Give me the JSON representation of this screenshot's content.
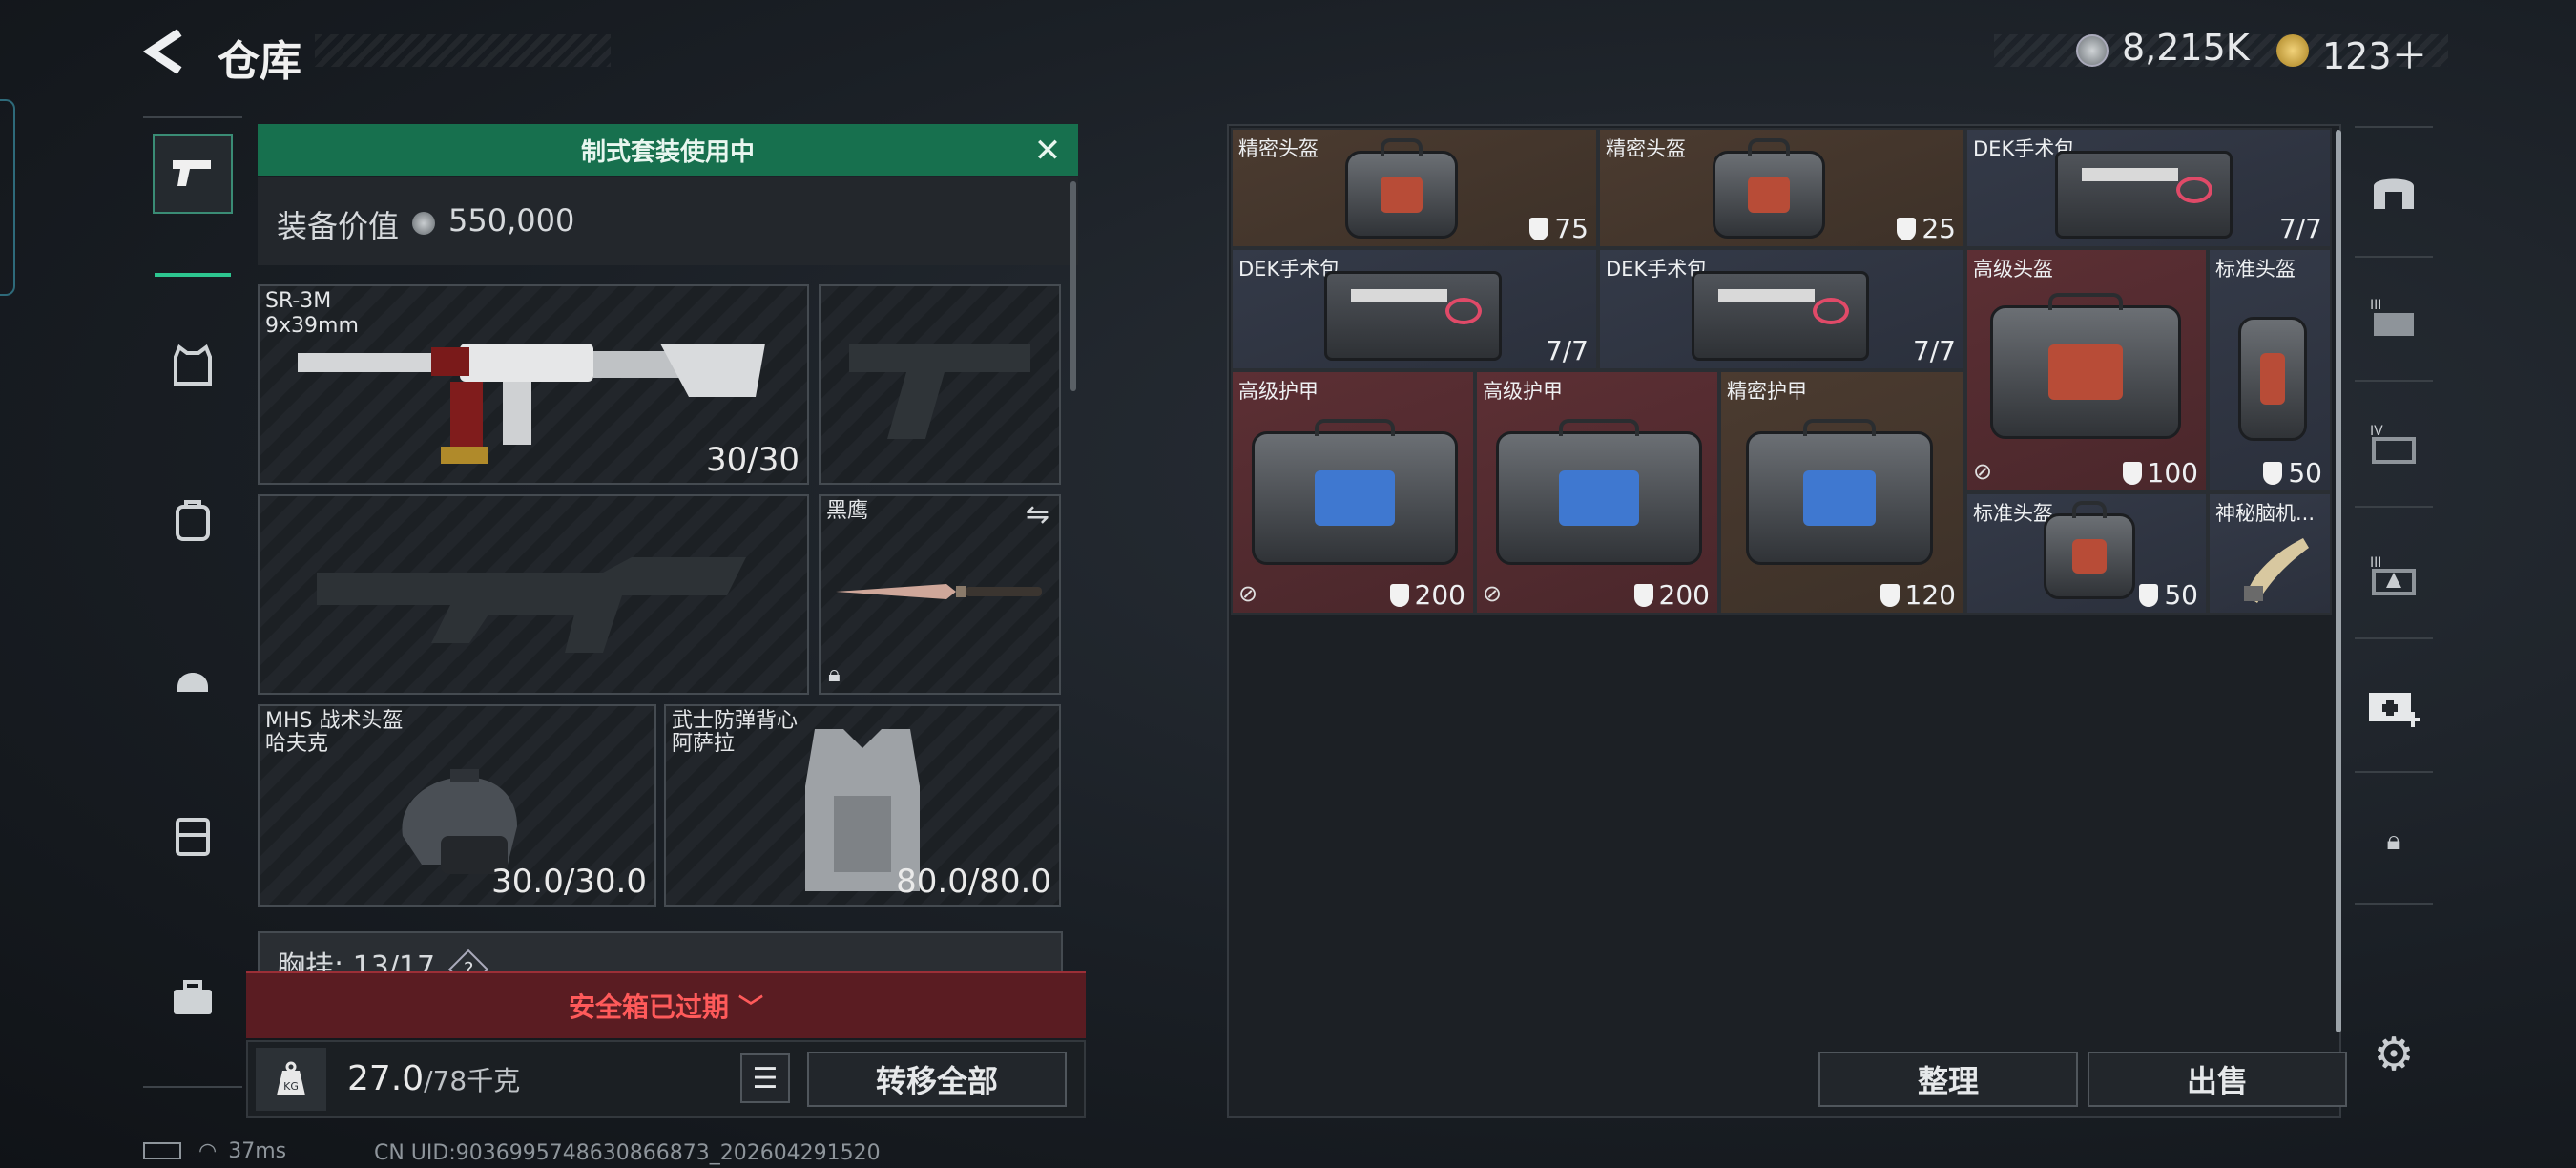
{
  "header": {
    "title": "仓库",
    "currency1": "8,215K",
    "currency2": "123＋"
  },
  "nav": {
    "items": [
      "pistol-icon",
      "armor-vest-icon",
      "backpack-icon",
      "helmet-icon",
      "chest-rig-icon",
      "toolbox-icon"
    ]
  },
  "loadout": {
    "banner": "制式套装使用中",
    "value_label": "装备价值",
    "value": "550,000",
    "primary": {
      "name": "SR-3M",
      "sub": "9x39mm",
      "ammo": "30/30"
    },
    "melee": {
      "name": "黑鹰"
    },
    "helmet": {
      "name": "MHS 战术头盔",
      "sub": "哈夫克",
      "durability": "30.0/30.0"
    },
    "vest": {
      "name": "武士防弹背心",
      "sub": "阿萨拉",
      "durability": "80.0/80.0"
    },
    "chest_label": "胸挂",
    "chest_count": "13/17",
    "chest_help": "?",
    "safebox": "安全箱已过期",
    "weight": "27.0",
    "weight_unit": "/78千克",
    "kg_label": "KG",
    "transfer_all": "转移全部"
  },
  "storage": {
    "items": [
      {
        "name": "精密头盔",
        "value": "75"
      },
      {
        "name": "精密头盔",
        "value": "25"
      },
      {
        "name": "DEK手术包",
        "value": "7/7"
      },
      {
        "name": "DEK手术包",
        "value": "7/7"
      },
      {
        "name": "DEK手术包",
        "value": "7/7"
      },
      {
        "name": "高级头盔",
        "value": "100"
      },
      {
        "name": "标准头盔",
        "value": "50"
      },
      {
        "name": "高级护甲",
        "value": "200"
      },
      {
        "name": "高级护甲",
        "value": "200"
      },
      {
        "name": "精密护甲",
        "value": "120"
      },
      {
        "name": "标准头盔",
        "value": "50"
      },
      {
        "name": "神秘脑机..."
      }
    ],
    "sort": "整理",
    "sell": "出售"
  },
  "status": {
    "ping": "37ms",
    "uid": "CN UID:9036995748630866873_202604291520"
  }
}
